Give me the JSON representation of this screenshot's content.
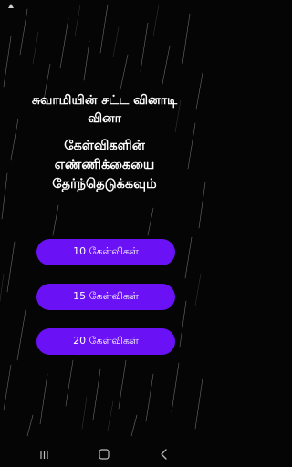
{
  "title": {
    "line1": "சுவாமியின் சட்ட வினாடி",
    "line2": "வினா"
  },
  "subtitle": {
    "line1": "கேள்விகளின்",
    "line2": "எண்ணிக்கையை",
    "line3": "தேர்ந்தெடுக்கவும்"
  },
  "options": [
    {
      "label": "10 கேள்விகள்"
    },
    {
      "label": "15 கேள்விகள்"
    },
    {
      "label": "20 கேள்விகள்"
    }
  ],
  "colors": {
    "background": "#050505",
    "button": "#6a12f5",
    "text": "#ffffff"
  },
  "icons": {
    "status": "notification-icon",
    "recents": "recents-icon",
    "home": "home-icon",
    "back": "back-icon"
  }
}
